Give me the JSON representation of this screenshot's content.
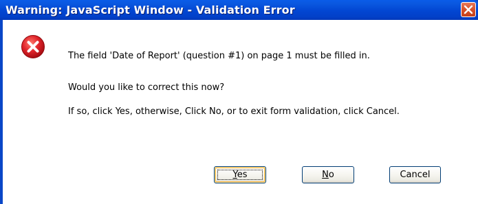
{
  "window": {
    "title": "Warning: JavaScript Window - Validation Error",
    "close_icon": "close-icon"
  },
  "dialog": {
    "icon": "error-icon",
    "message_line1": "The field 'Date of Report' (question #1) on page 1 must be filled in.",
    "message_line2": "Would you like to correct this now?",
    "message_line3": "If so, click Yes, otherwise, Click No, or to exit form validation, click Cancel."
  },
  "buttons": {
    "yes_mnemonic": "Y",
    "yes_rest": "es",
    "no_mnemonic": "N",
    "no_rest": "o",
    "cancel": "Cancel"
  },
  "colors": {
    "titlebar": "#0246d2",
    "close_button": "#d9532c",
    "error_icon": "#d8141c",
    "focus_highlight": "#f9b33e"
  }
}
